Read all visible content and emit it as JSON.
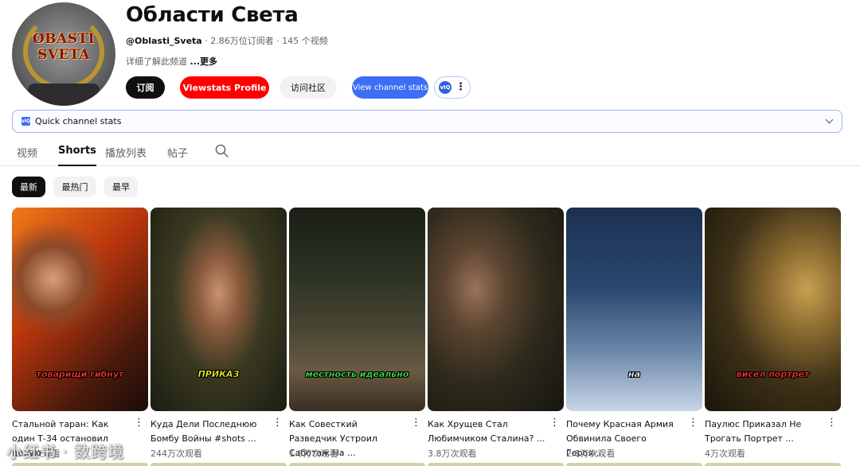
{
  "channel": {
    "avatar_text": "OBASTI SVETA",
    "title": "Области Света",
    "handle": "@Oblasti_Sveta",
    "subscribers": "2.86万位订阅者",
    "video_count": "145 个视频",
    "separator": "·",
    "description": "详细了解此频道",
    "more_label": "...更多"
  },
  "buttons": {
    "subscribe": "订阅",
    "viewstats": "Viewstats Profile",
    "community": "访问社区",
    "view_channel_stats": "View channel stats",
    "ext_icon": "vIQ",
    "ext_menu_icon": "more-vertical-icon"
  },
  "quick_stats": {
    "icon": "vIQ",
    "label": "Quick channel stats"
  },
  "tabs": [
    {
      "label": "视频"
    },
    {
      "label": "Shorts",
      "active": true
    },
    {
      "label": "播放列表"
    },
    {
      "label": "帖子"
    }
  ],
  "chips": [
    {
      "label": "最新",
      "active": true
    },
    {
      "label": "最热门"
    },
    {
      "label": "最早"
    }
  ],
  "shorts": [
    {
      "caption": "товарищи гибнут",
      "caption_color": "#ff3030",
      "title": "Стальной таран: Как один Т-34 остановил целую ...",
      "views": "3573次观看"
    },
    {
      "caption": "ПРИКАЗ",
      "caption_color": "#f5f020",
      "title": "Куда Дели Последнюю Бомбу Войны #shots ...",
      "views": "244万次观看"
    },
    {
      "caption": "местность идеально",
      "caption_color": "#37e84a",
      "title": "Как Совесткий Разведчик Устроил Саботаж На ...",
      "views": "1.8万次观看"
    },
    {
      "caption": "",
      "caption_color": "#ffffff",
      "title": "Как Хрущев Стал Любимчиком Сталина? ...",
      "views": "3.8万次观看"
    },
    {
      "caption": "на",
      "caption_color": "#ffffff",
      "title": "Почему Красная Армия Обвинила Своего Героя-...",
      "views": "2.8万次观看"
    },
    {
      "caption": "висел портрет",
      "caption_color": "#ff3030",
      "title": "Паулюс Приказал Не Трогать Портрет ...",
      "views": "4万次观看"
    }
  ],
  "watermark": "小红书 · 数跨境"
}
